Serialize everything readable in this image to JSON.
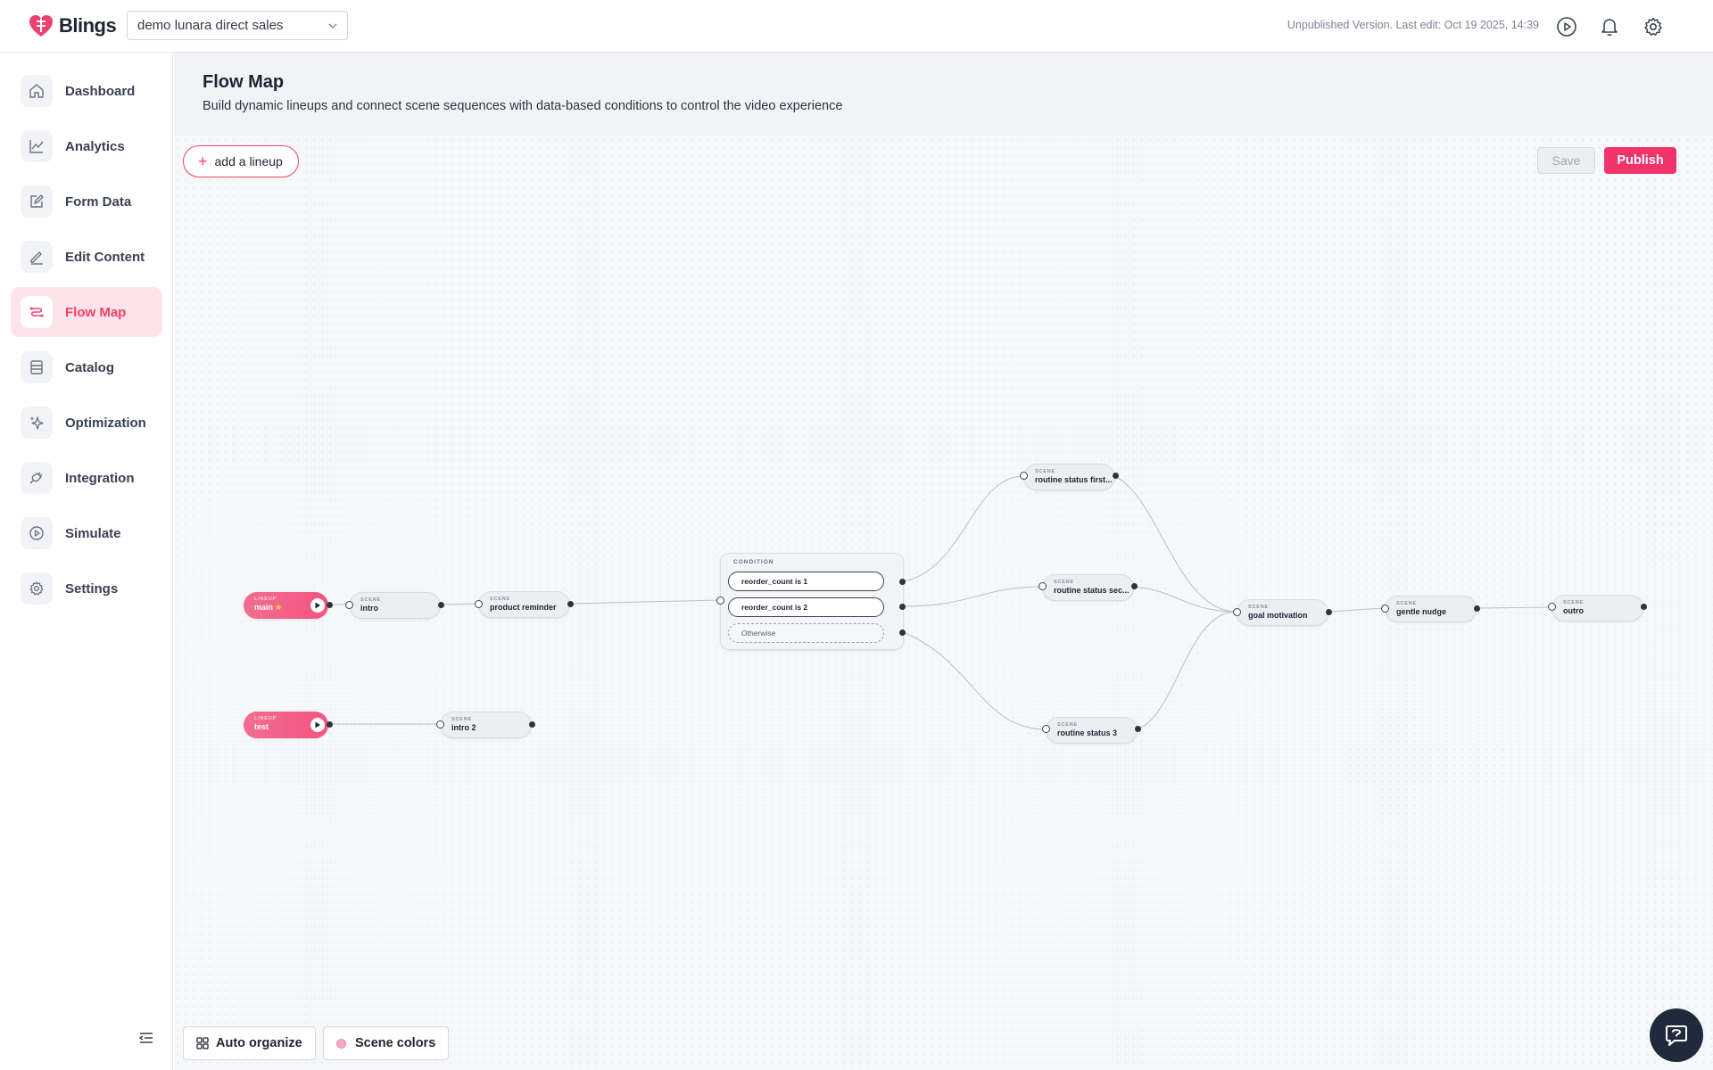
{
  "app": {
    "name": "Blings",
    "brand_color": "#f0406c"
  },
  "project_select": {
    "value": "demo lunara direct sales"
  },
  "header": {
    "version_text": "Unpublished Version. Last edit: Oct 19 2025, 14:39",
    "icons": [
      "play-icon",
      "bell-icon",
      "gear-icon"
    ]
  },
  "sidebar": {
    "items": [
      {
        "label": "Dashboard",
        "icon": "home-icon",
        "active": false
      },
      {
        "label": "Analytics",
        "icon": "chart-icon",
        "active": false
      },
      {
        "label": "Form Data",
        "icon": "edit-form-icon",
        "active": false
      },
      {
        "label": "Edit Content",
        "icon": "pencil-icon",
        "active": false
      },
      {
        "label": "Flow Map",
        "icon": "flow-icon",
        "active": true
      },
      {
        "label": "Catalog",
        "icon": "catalog-icon",
        "active": false
      },
      {
        "label": "Optimization",
        "icon": "sparkle-icon",
        "active": false
      },
      {
        "label": "Integration",
        "icon": "plug-icon",
        "active": false
      },
      {
        "label": "Simulate",
        "icon": "play-circle-icon",
        "active": false
      },
      {
        "label": "Settings",
        "icon": "gear-icon",
        "active": false
      }
    ]
  },
  "page": {
    "title": "Flow Map",
    "subtitle": "Build dynamic lineups and connect scene sequences with data-based conditions to control the video experience"
  },
  "toolbar": {
    "add_lineup": "add a lineup",
    "save": "Save",
    "publish": "Publish"
  },
  "flow": {
    "lineup_kind": "LINEUP",
    "scene_kind": "SCENE",
    "condition_kind": "CONDITION",
    "lineups": [
      {
        "name": "main",
        "starred": true
      },
      {
        "name": "test",
        "starred": false
      }
    ],
    "scenes": {
      "intro": "intro",
      "product_reminder": "product reminder",
      "routine_first": "routine status first...",
      "routine_second": "routine status sec...",
      "routine_3": "routine status 3",
      "goal_motivation": "goal motivation",
      "gentle_nudge": "gentle nudge",
      "outro": "outro",
      "intro2": "intro 2"
    },
    "condition": {
      "rows": [
        "reorder_count is 1",
        "reorder_count is 2"
      ],
      "otherwise": "Otherwise"
    }
  },
  "bottom": {
    "auto_organize": "Auto organize",
    "scene_colors": "Scene colors"
  }
}
